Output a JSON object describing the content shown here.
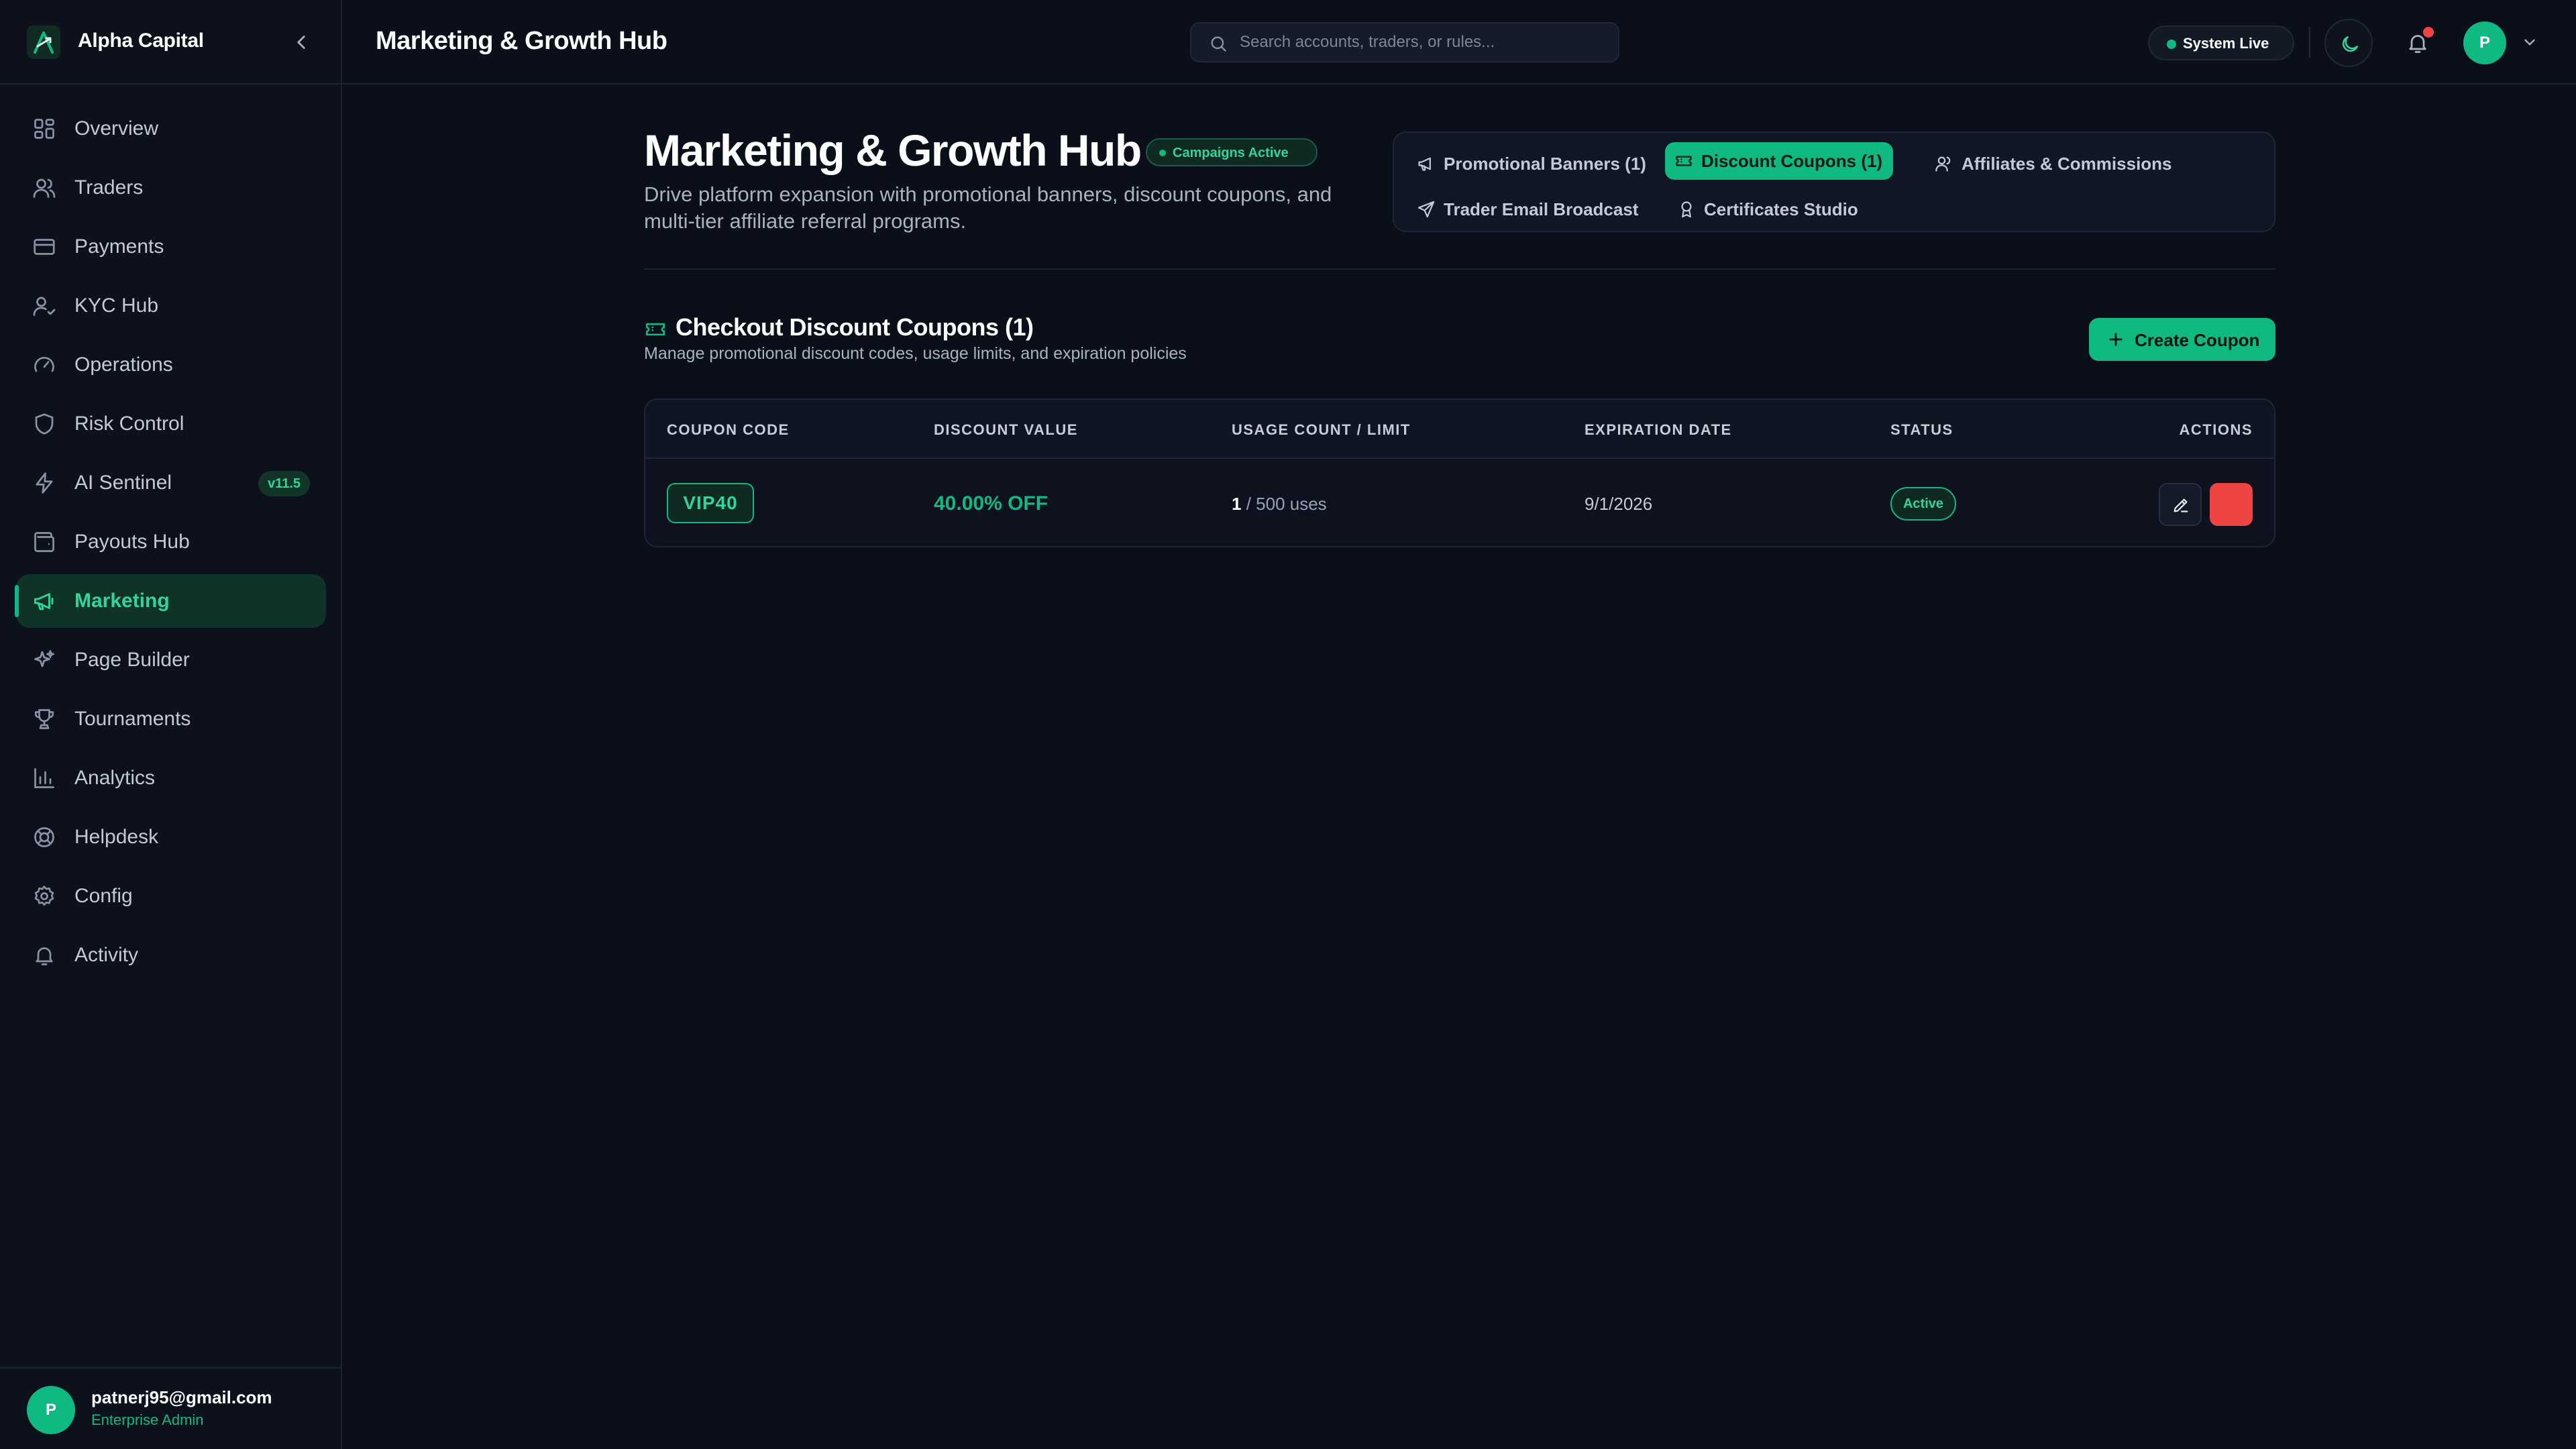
{
  "brand": {
    "name": "Alpha Capital"
  },
  "topbar": {
    "title": "Marketing & Growth Hub",
    "search_placeholder": "Search accounts, traders, or rules...",
    "status": "System Live",
    "avatar_initial": "P"
  },
  "sidebar": {
    "items": [
      {
        "label": "Overview",
        "icon": "grid-icon"
      },
      {
        "label": "Traders",
        "icon": "users-icon"
      },
      {
        "label": "Payments",
        "icon": "credit-card-icon"
      },
      {
        "label": "KYC Hub",
        "icon": "user-check-icon"
      },
      {
        "label": "Operations",
        "icon": "gauge-icon"
      },
      {
        "label": "Risk Control",
        "icon": "shield-icon"
      },
      {
        "label": "AI Sentinel",
        "icon": "zap-icon",
        "badge": "v11.5"
      },
      {
        "label": "Payouts Hub",
        "icon": "wallet-icon"
      },
      {
        "label": "Marketing",
        "icon": "megaphone-icon",
        "active": true
      },
      {
        "label": "Page Builder",
        "icon": "sparkles-icon"
      },
      {
        "label": "Tournaments",
        "icon": "trophy-icon"
      },
      {
        "label": "Analytics",
        "icon": "bar-chart-icon"
      },
      {
        "label": "Helpdesk",
        "icon": "lifebuoy-icon"
      },
      {
        "label": "Config",
        "icon": "gear-icon"
      },
      {
        "label": "Activity",
        "icon": "bell-icon"
      }
    ],
    "user": {
      "initial": "P",
      "email": "patnerj95@gmail.com",
      "role": "Enterprise Admin"
    }
  },
  "main": {
    "title": "Marketing & Growth Hub",
    "badge": "Campaigns Active",
    "description": "Drive platform expansion with promotional banners, discount coupons, and multi-tier affiliate referral programs.",
    "tabs": [
      {
        "label": "Promotional Banners (1)",
        "icon": "megaphone-icon"
      },
      {
        "label": "Discount Coupons (1)",
        "icon": "ticket-icon",
        "active": true
      },
      {
        "label": "Affiliates & Commissions",
        "icon": "users-icon"
      },
      {
        "label": "Trader Email Broadcast",
        "icon": "send-icon"
      },
      {
        "label": "Certificates Studio",
        "icon": "award-icon"
      }
    ],
    "section": {
      "title": "Checkout Discount Coupons (1)",
      "subtitle": "Manage promotional discount codes, usage limits, and expiration policies",
      "create_label": "Create Coupon"
    },
    "table": {
      "headers": [
        "COUPON CODE",
        "DISCOUNT VALUE",
        "USAGE COUNT / LIMIT",
        "EXPIRATION DATE",
        "STATUS",
        "ACTIONS"
      ],
      "rows": [
        {
          "code": "VIP40",
          "discount": "40.00% OFF",
          "usage_count": "1",
          "usage_limit": "/ 500 uses",
          "expiration": "9/1/2026",
          "status": "Active"
        }
      ]
    }
  },
  "colors": {
    "accent": "#10b981",
    "danger": "#ef4444",
    "background": "#0b0f1a"
  }
}
